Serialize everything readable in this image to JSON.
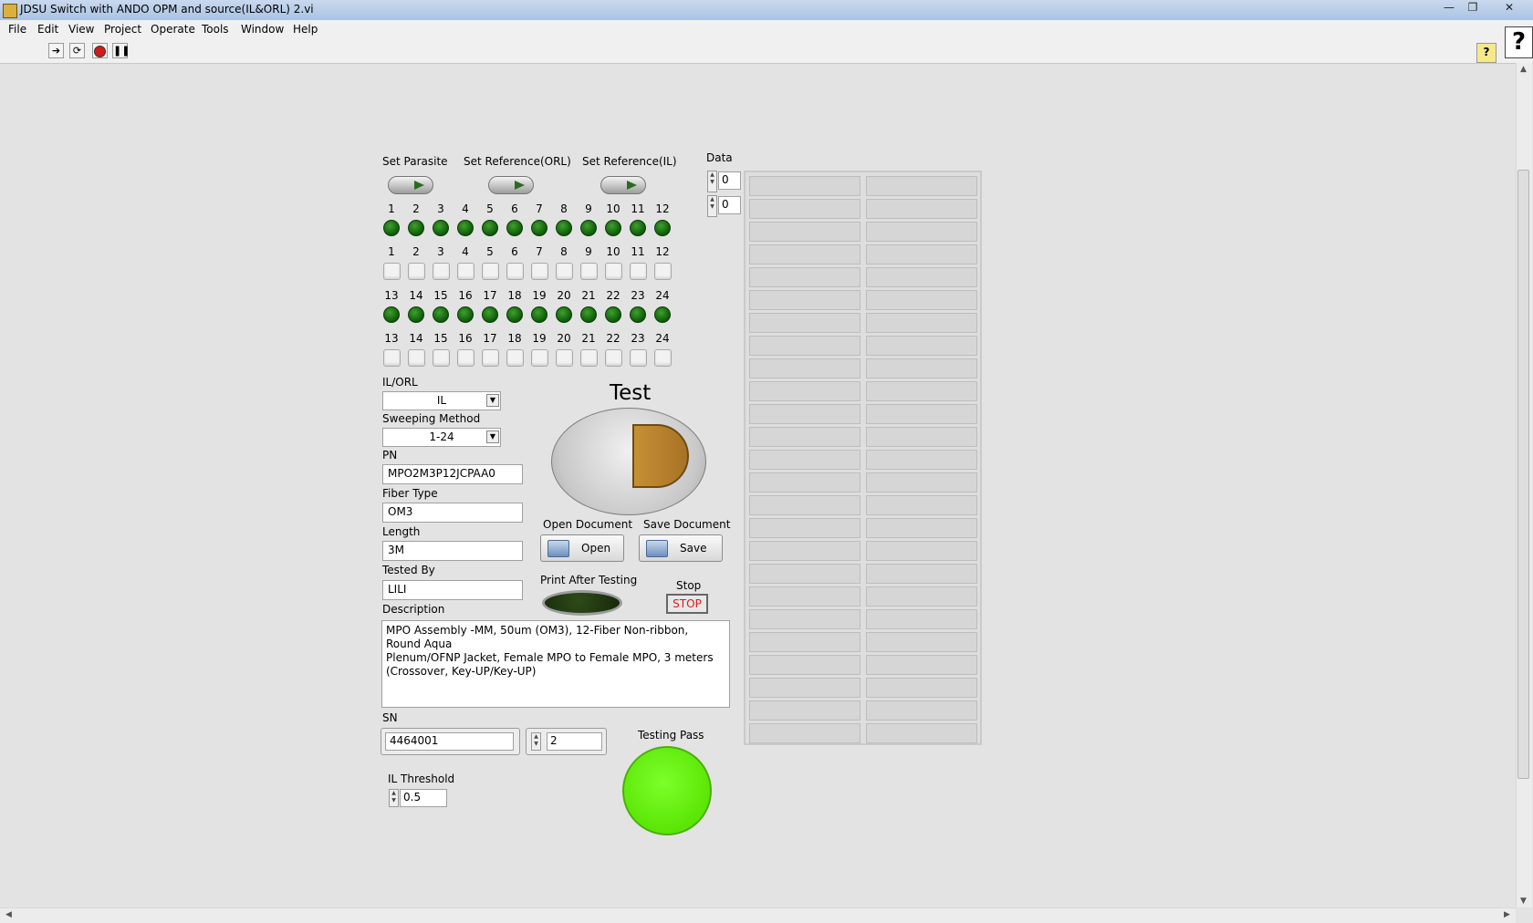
{
  "window": {
    "title": "JDSU Switch with ANDO OPM and source(IL&ORL) 2.vi",
    "minimize_glyph": "—",
    "restore_glyph": "❐",
    "close_glyph": "✕"
  },
  "menu": [
    "File",
    "Edit",
    "View",
    "Project",
    "Operate",
    "Tools",
    "Window",
    "Help"
  ],
  "toolbar": {
    "run_icon": "run-arrow-icon",
    "run_continuous_icon": "run-continuously-icon",
    "abort_icon": "abort-icon",
    "pause_icon": "pause-icon",
    "context_help_glyph": "?",
    "help_glyph": "?"
  },
  "panel": {
    "set_parasite_label": "Set Parasite",
    "set_ref_orl_label": "Set Reference(ORL)",
    "set_ref_il_label": "Set Reference(IL)",
    "row1_leds": [
      "1",
      "2",
      "3",
      "4",
      "5",
      "6",
      "7",
      "8",
      "9",
      "10",
      "11",
      "12"
    ],
    "row1_checks": [
      "1",
      "2",
      "3",
      "4",
      "5",
      "6",
      "7",
      "8",
      "9",
      "10",
      "11",
      "12"
    ],
    "row2_leds": [
      "13",
      "14",
      "15",
      "16",
      "17",
      "18",
      "19",
      "20",
      "21",
      "22",
      "23",
      "24"
    ],
    "row2_checks": [
      "13",
      "14",
      "15",
      "16",
      "17",
      "18",
      "19",
      "20",
      "21",
      "22",
      "23",
      "24"
    ],
    "ilorl_label": "IL/ORL",
    "ilorl_value": "IL",
    "sweep_label": "Sweeping Method",
    "sweep_value": "1-24",
    "pn_label": "PN",
    "pn_value": "MPO2M3P12JCPAA0",
    "fiber_label": "Fiber Type",
    "fiber_value": "OM3",
    "length_label": "Length",
    "length_value": "3M",
    "tested_label": "Tested By",
    "tested_value": "LILI",
    "description_label": "Description",
    "description_value": "MPO Assembly -MM, 50um (OM3), 12-Fiber Non-ribbon, Round Aqua\nPlenum/OFNP Jacket, Female MPO to Female MPO, 3 meters\n(Crossover, Key-UP/Key-UP)",
    "test_label": "Test",
    "open_doc_label": "Open Document",
    "open_btn": "Open",
    "save_doc_label": "Save Document",
    "save_btn": "Save",
    "print_label": "Print After Testing",
    "stop_label": "Stop",
    "stop_btn": "STOP",
    "sn_label": "SN",
    "sn_value": "4464001",
    "sn_count": "2",
    "il_threshold_label": "IL Threshold",
    "il_threshold_value": "0.5",
    "testing_pass_label": "Testing Pass",
    "testing_pass_color": "#5be606",
    "led_on_color": "#1f7a14"
  },
  "data_array": {
    "label": "Data",
    "index_row": "0",
    "index_col": "0",
    "rows": 25,
    "cols": 2
  }
}
